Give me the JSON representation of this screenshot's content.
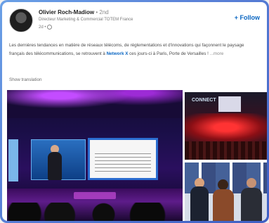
{
  "post": {
    "author": {
      "name": "Olivier Roch-Madiow",
      "degree": "• 2nd",
      "headline": "Directeur Marketing & Commercial TOTEM France",
      "time": "2d •"
    },
    "follow_label": "+ Follow",
    "text_before_mention": "Les dernières tendances en matière de réseaux télécoms, de réglementations et d'innovations qui façonnent le paysage français des télécommunications, se retrouvent à ",
    "mention": "Network X",
    "text_after_mention": " ces jours-ci à Paris, Porte de Versailles ! ",
    "more_label": "...more",
    "show_translation": "Show translation"
  },
  "images": {
    "top_right_sign": "CONNECT"
  },
  "colors": {
    "link": "#0a66c2",
    "frame_border": "#5a82d8"
  }
}
